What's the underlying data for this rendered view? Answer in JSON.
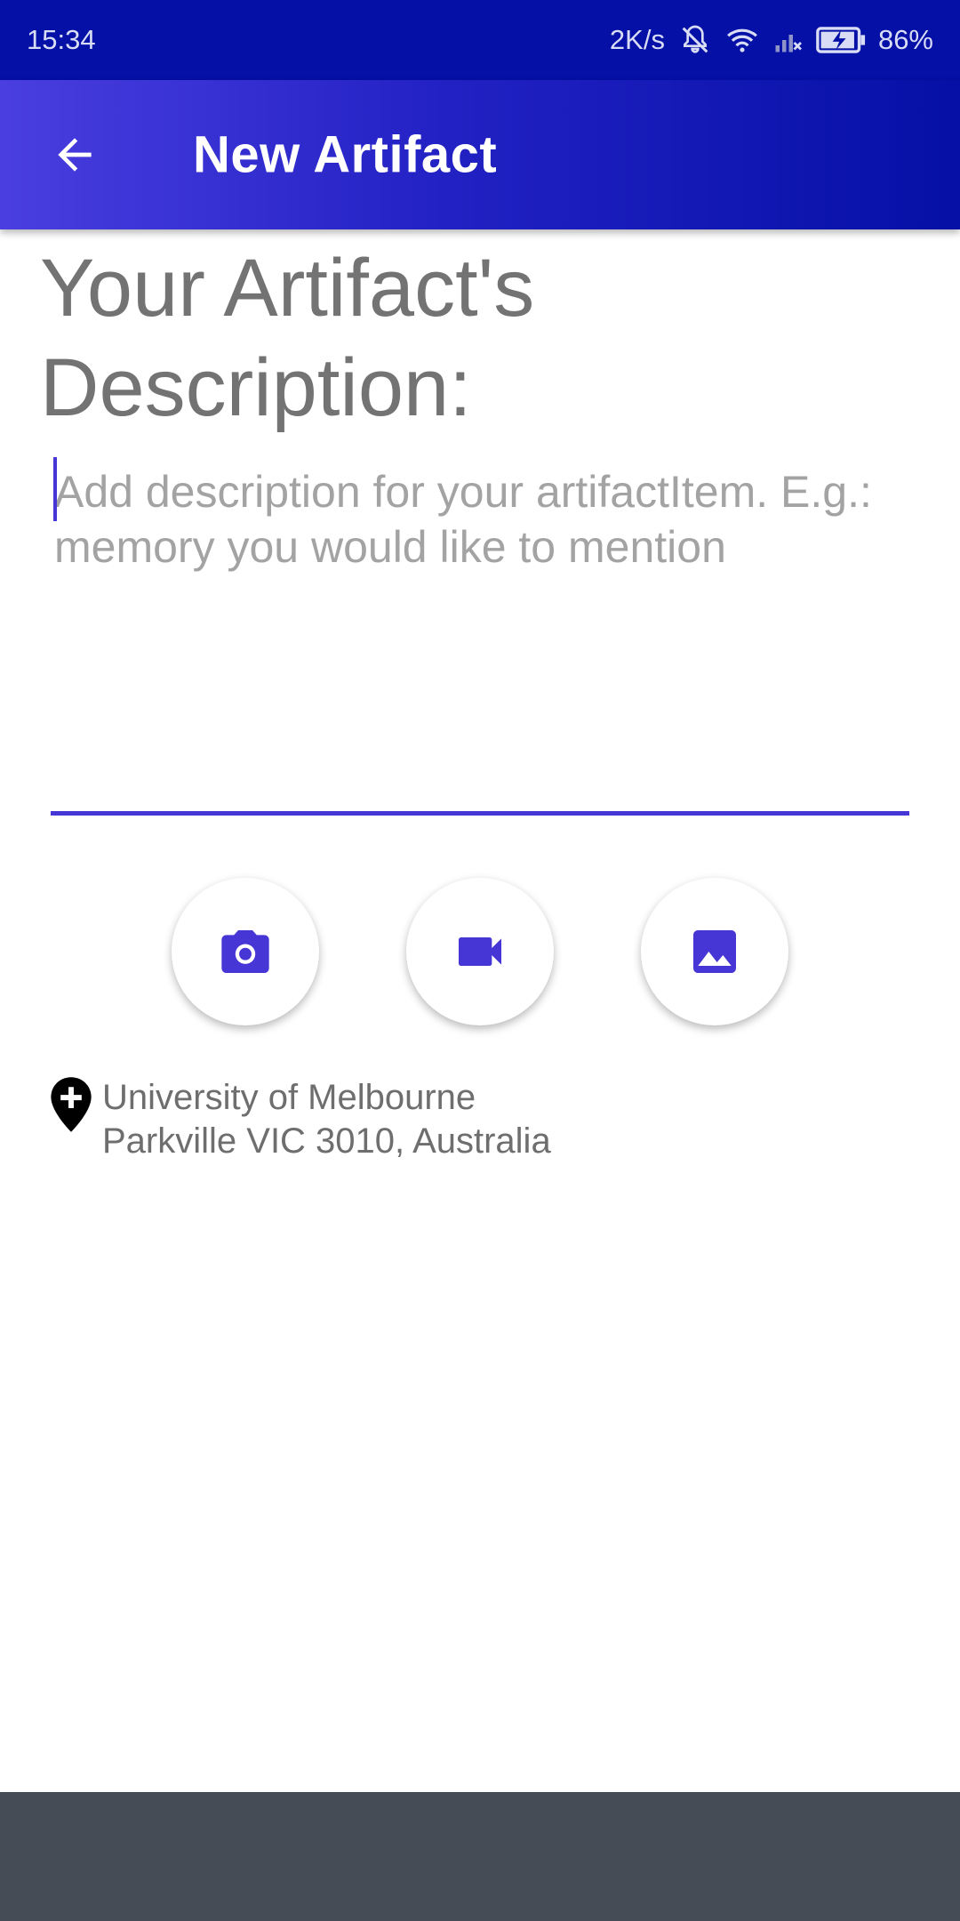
{
  "status_bar": {
    "time": "15:34",
    "net_speed": "2K/s",
    "battery": "86%",
    "icons": [
      "mute-bell-icon",
      "wifi-icon",
      "signal-icon",
      "battery-charging-icon"
    ]
  },
  "app_bar": {
    "back_icon": "arrow-back-icon",
    "title": "New Artifact",
    "colors": {
      "start": "#4a3ee0",
      "end": "#0510a6"
    }
  },
  "main": {
    "heading": "Your Artifact's Description:",
    "description": {
      "value": "",
      "placeholder": "Add description for your artifactItem. E.g.: memory you would like to mention"
    },
    "accent_color": "#4636d6",
    "media_buttons": [
      {
        "icon": "camera-icon"
      },
      {
        "icon": "videocam-icon"
      },
      {
        "icon": "image-icon"
      }
    ],
    "location": {
      "icon": "add-location-icon",
      "line1": "University of Melbourne",
      "line2": "Parkville VIC 3010, Australia"
    }
  }
}
